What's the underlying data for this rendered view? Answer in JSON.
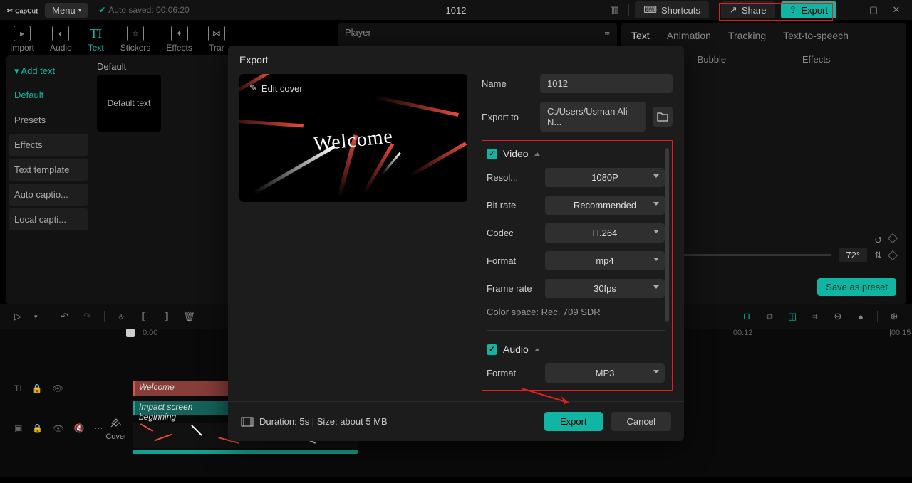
{
  "brand": "CapCut",
  "menu": "Menu",
  "autosaved": "Auto saved: 00:06:20",
  "project_title": "1012",
  "shortcuts": "Shortcuts",
  "share": "Share",
  "export": "Export",
  "top_tabs": [
    {
      "label": "Import"
    },
    {
      "label": "Audio"
    },
    {
      "label": "Text"
    },
    {
      "label": "Stickers"
    },
    {
      "label": "Effects"
    },
    {
      "label": "Trar"
    }
  ],
  "sidebar": {
    "title": "Add text",
    "items": [
      {
        "label": "Default"
      },
      {
        "label": "Presets"
      },
      {
        "label": "Effects",
        "btn": true
      },
      {
        "label": "Text template",
        "btn": true
      },
      {
        "label": "Auto captio...",
        "btn": true
      },
      {
        "label": "Local capti...",
        "btn": true
      }
    ]
  },
  "gallery": {
    "head": "Default",
    "thumb": "Default text"
  },
  "player": "Player",
  "rtabs": [
    "Text",
    "Animation",
    "Tracking",
    "Text-to-speech"
  ],
  "rsub": [
    "Bubble",
    "Effects"
  ],
  "rotate": "72°",
  "save_preset": "Save as preset",
  "ruler": [
    "0:00",
    "|00:12",
    "|00:15"
  ],
  "clip_text": "Welcome",
  "clip_fx": "Impact screen beginning",
  "cover_btn": "Cover",
  "modal": {
    "title": "Export",
    "edit_cover": "Edit cover",
    "welcome": "Welcome",
    "name_label": "Name",
    "name_value": "1012",
    "exportto_label": "Export to",
    "exportto_value": "C:/Users/Usman Ali N...",
    "video": "Video",
    "rows": [
      {
        "label": "Resol...",
        "value": "1080P"
      },
      {
        "label": "Bit rate",
        "value": "Recommended"
      },
      {
        "label": "Codec",
        "value": "H.264"
      },
      {
        "label": "Format",
        "value": "mp4"
      },
      {
        "label": "Frame rate",
        "value": "30fps"
      }
    ],
    "color_space": "Color space: Rec. 709 SDR",
    "audio": "Audio",
    "audio_format_label": "Format",
    "audio_format_value": "MP3",
    "duration": "Duration: 5s | Size: about 5 MB",
    "export_btn": "Export",
    "cancel": "Cancel"
  }
}
